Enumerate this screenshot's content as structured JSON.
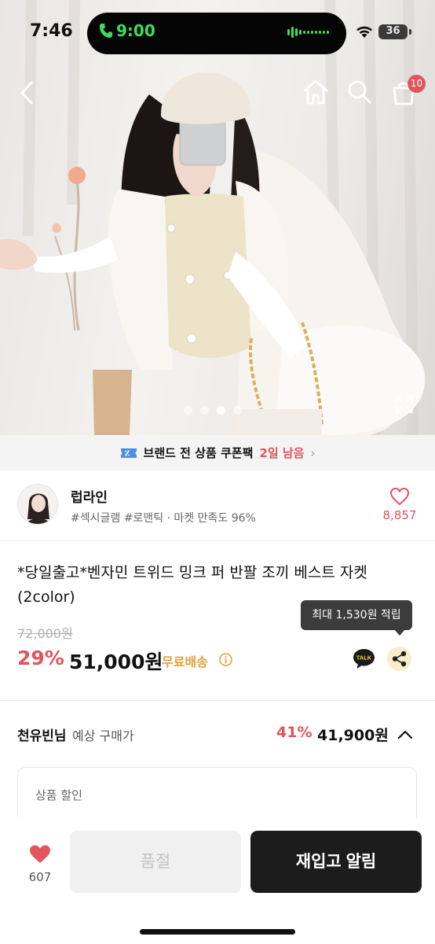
{
  "status_bar": {
    "time": "7:46",
    "call_time": "9:00",
    "battery": "36"
  },
  "nav": {
    "cart_count": "10",
    "icons": [
      "back-arrow-icon",
      "home-icon",
      "search-icon",
      "shopping-bag-icon"
    ]
  },
  "gallery": {
    "dot_count": 4,
    "active_dot": 3
  },
  "coupon_banner": {
    "text": "브랜드 전 상품 쿠폰팩",
    "days_left": "2일 남음",
    "chevron": "›"
  },
  "brand": {
    "name": "럽라인",
    "tags": "#섹시글램 #로맨틱 · 마켓 만족도 96%",
    "likes": "8,857"
  },
  "product": {
    "title": "*당일출고*벤자민 트위드 밍크 퍼 반팔 조끼 베스트 자켓 (2color)",
    "original_price": "72,000원",
    "discount": "29%",
    "price": "51,000원",
    "free_shipping": "무료배송",
    "points_tooltip": "최대 1,530원 적립",
    "talk_label": "TALK"
  },
  "member_price": {
    "name": "천유빈님",
    "label": "예상 구매가",
    "discount": "41%",
    "price": "41,900원"
  },
  "discount_section": {
    "label": "상품 할인"
  },
  "bottom_bar": {
    "wish_count": "607",
    "soldout_label": "품절",
    "restock_label": "재입고 알림"
  },
  "colors": {
    "accent_red": "#e2545e",
    "free_ship_orange": "#e2a13a",
    "call_green": "#3ddc5c",
    "dark_button": "#1c1c1c"
  }
}
